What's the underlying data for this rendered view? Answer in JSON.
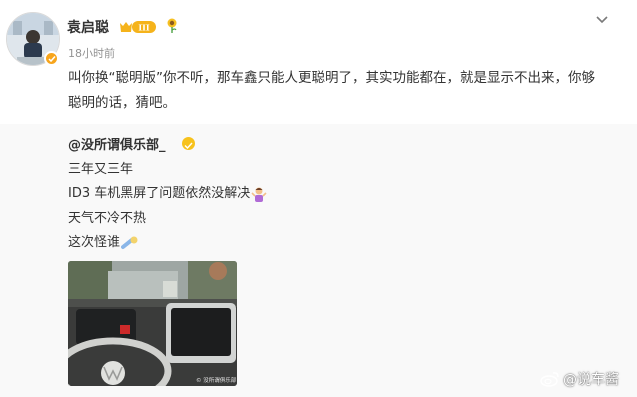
{
  "post": {
    "username": "袁启聪",
    "vip_level": "III",
    "timestamp": "18小时前",
    "text": "叫你换“聪明版”你不听，那车鑫只能人更聪明了，其实功能都在，就是显示不出来，你够聪明的话，猜吧。"
  },
  "repost": {
    "author": "@没所谓俱乐部_",
    "lines": [
      "三年又三年",
      "ID3 车机黑屏了问题依然没解决",
      "天气不冷不热",
      "这次怪谁"
    ],
    "image_caption": "© 没所谓俱乐部"
  },
  "watermark": {
    "text": "@说车酱"
  },
  "icons": {
    "chevron": "chevron-down-icon",
    "verify": "verified-badge-icon",
    "vip": "vip-crown-icon",
    "flower": "sunflower-icon",
    "facepalm": "person-shrugging-emoji-icon",
    "blame": "pointing-emoji-icon",
    "weibo": "weibo-logo-icon"
  },
  "colors": {
    "verify": "#f7a51c",
    "vip": "#f5b31b",
    "muted_text": "#939393",
    "repost_bg": "#f9f9f9"
  }
}
